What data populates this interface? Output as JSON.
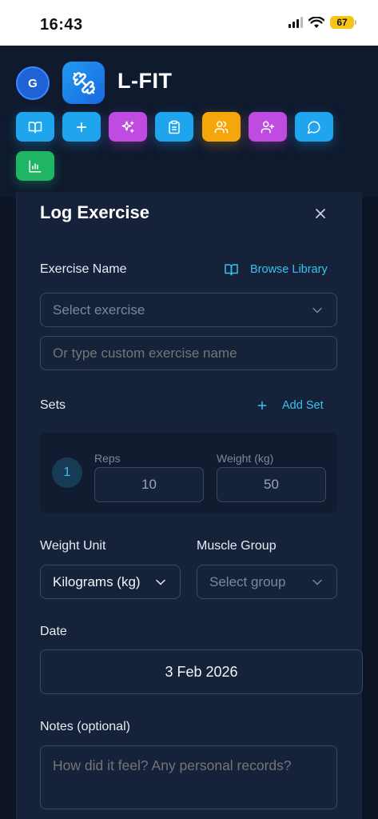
{
  "status_bar": {
    "time": "16:43",
    "battery": "67"
  },
  "header": {
    "avatar_initial": "G",
    "app_title": "L-FIT"
  },
  "nav": [
    {
      "icon": "book-open-icon",
      "color": "#1fa5ee"
    },
    {
      "icon": "plus-icon",
      "color": "#1fa5ee"
    },
    {
      "icon": "sparkles-icon",
      "color": "#c04be0"
    },
    {
      "icon": "clipboard-icon",
      "color": "#1fa5ee"
    },
    {
      "icon": "users-icon",
      "color": "#f5a60b"
    },
    {
      "icon": "user-plus-icon",
      "color": "#c04be0"
    },
    {
      "icon": "chat-icon",
      "color": "#1fa5ee"
    },
    {
      "icon": "bar-chart-icon",
      "color": "#20b465"
    }
  ],
  "form": {
    "title": "Log Exercise",
    "exercise_name_label": "Exercise Name",
    "browse_library": "Browse Library",
    "exercise_select_placeholder": "Select exercise",
    "custom_name_placeholder": "Or type custom exercise name",
    "sets_label": "Sets",
    "add_set": "Add Set",
    "sets": [
      {
        "number": "1",
        "reps": "10",
        "weight": "50"
      }
    ],
    "reps_label": "Reps",
    "weight_label": "Weight (kg)",
    "weight_unit_label": "Weight Unit",
    "weight_unit_value": "Kilograms (kg)",
    "muscle_group_label": "Muscle Group",
    "muscle_group_placeholder": "Select group",
    "date_label": "Date",
    "date_value": "3 Feb 2026",
    "notes_label": "Notes (optional)",
    "notes_placeholder": "How did it feel? Any personal records?"
  }
}
